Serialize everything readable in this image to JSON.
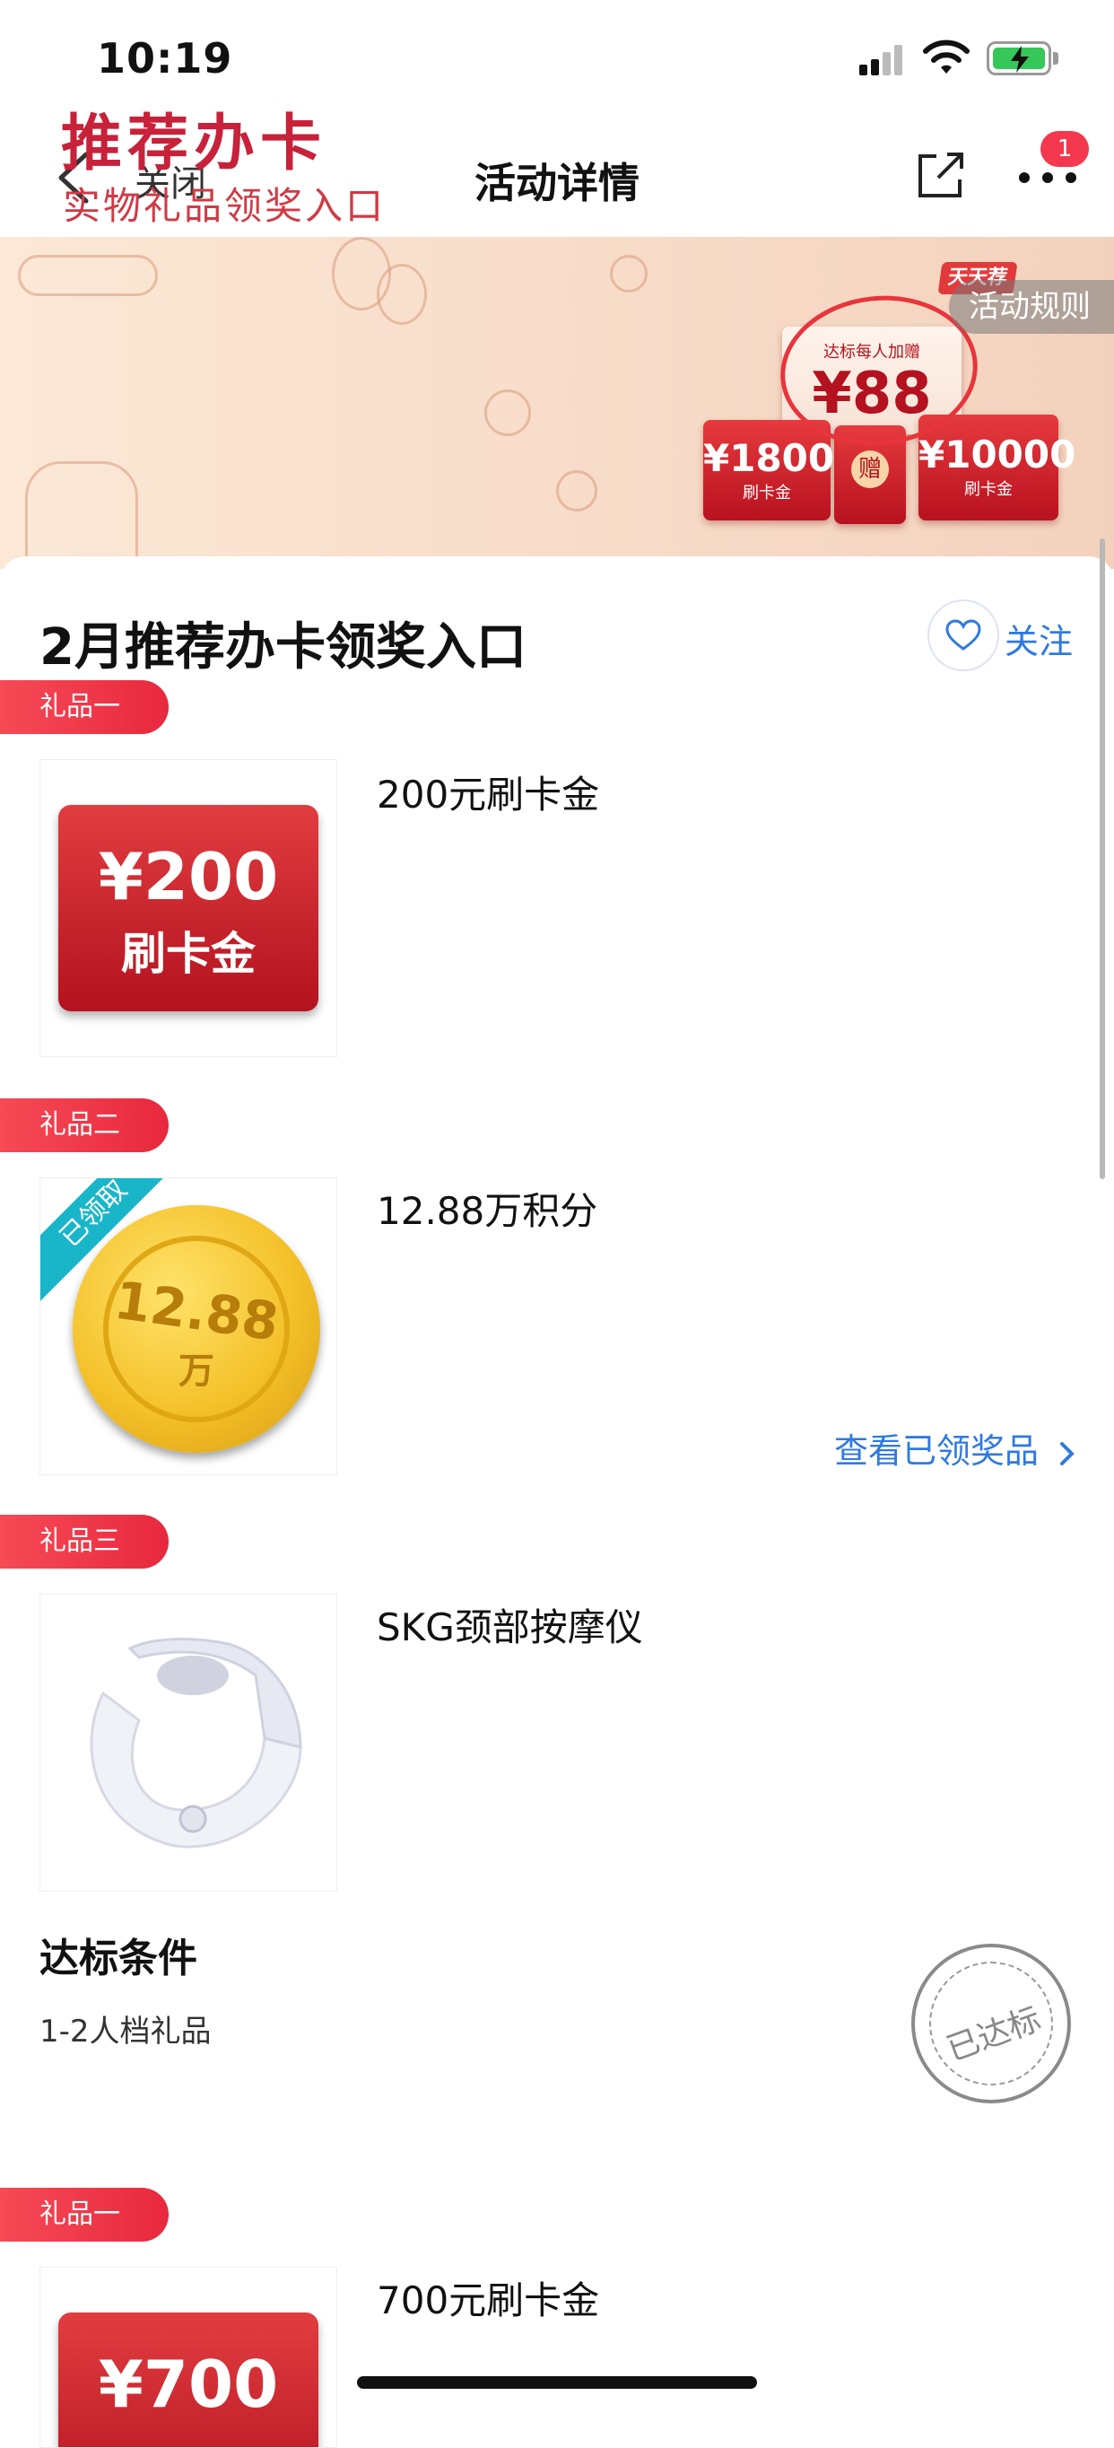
{
  "status_bar": {
    "time": "10:19"
  },
  "nav": {
    "close_label": "关闭",
    "title": "活动详情",
    "badge": "1"
  },
  "banner": {
    "title": "推荐办卡",
    "subtitle": "实物礼品领奖入口",
    "rules_label": "活动规则",
    "tiantian_label": "天天荐",
    "bonus_small": "达标每人加赠",
    "bonus_value": "¥88",
    "card_left": "¥1800",
    "card_right": "¥10000",
    "card_sub": "刷卡金",
    "gift_label": "赠"
  },
  "page": {
    "title": "2月推荐办卡领奖入口",
    "follow_label": "关注"
  },
  "gifts": [
    {
      "tag": "礼品一",
      "name": "200元刷卡金",
      "image_amount": "¥200",
      "image_label": "刷卡金"
    },
    {
      "tag": "礼品二",
      "name": "12.88万积分",
      "coin_value": "12.88",
      "coin_unit": "万",
      "ribbon": "已领取",
      "link": "查看已领奖品"
    },
    {
      "tag": "礼品三",
      "name": "SKG颈部按摩仪"
    },
    {
      "tag": "礼品一",
      "name": "700元刷卡金",
      "image_amount": "¥700"
    }
  ],
  "condition": {
    "title": "达标条件",
    "text": "1-2人档礼品",
    "stamp": "已达标"
  },
  "colors": {
    "accent_red": "#e8283e",
    "link_blue": "#2f7ae0",
    "received_teal": "#19b6c9"
  }
}
